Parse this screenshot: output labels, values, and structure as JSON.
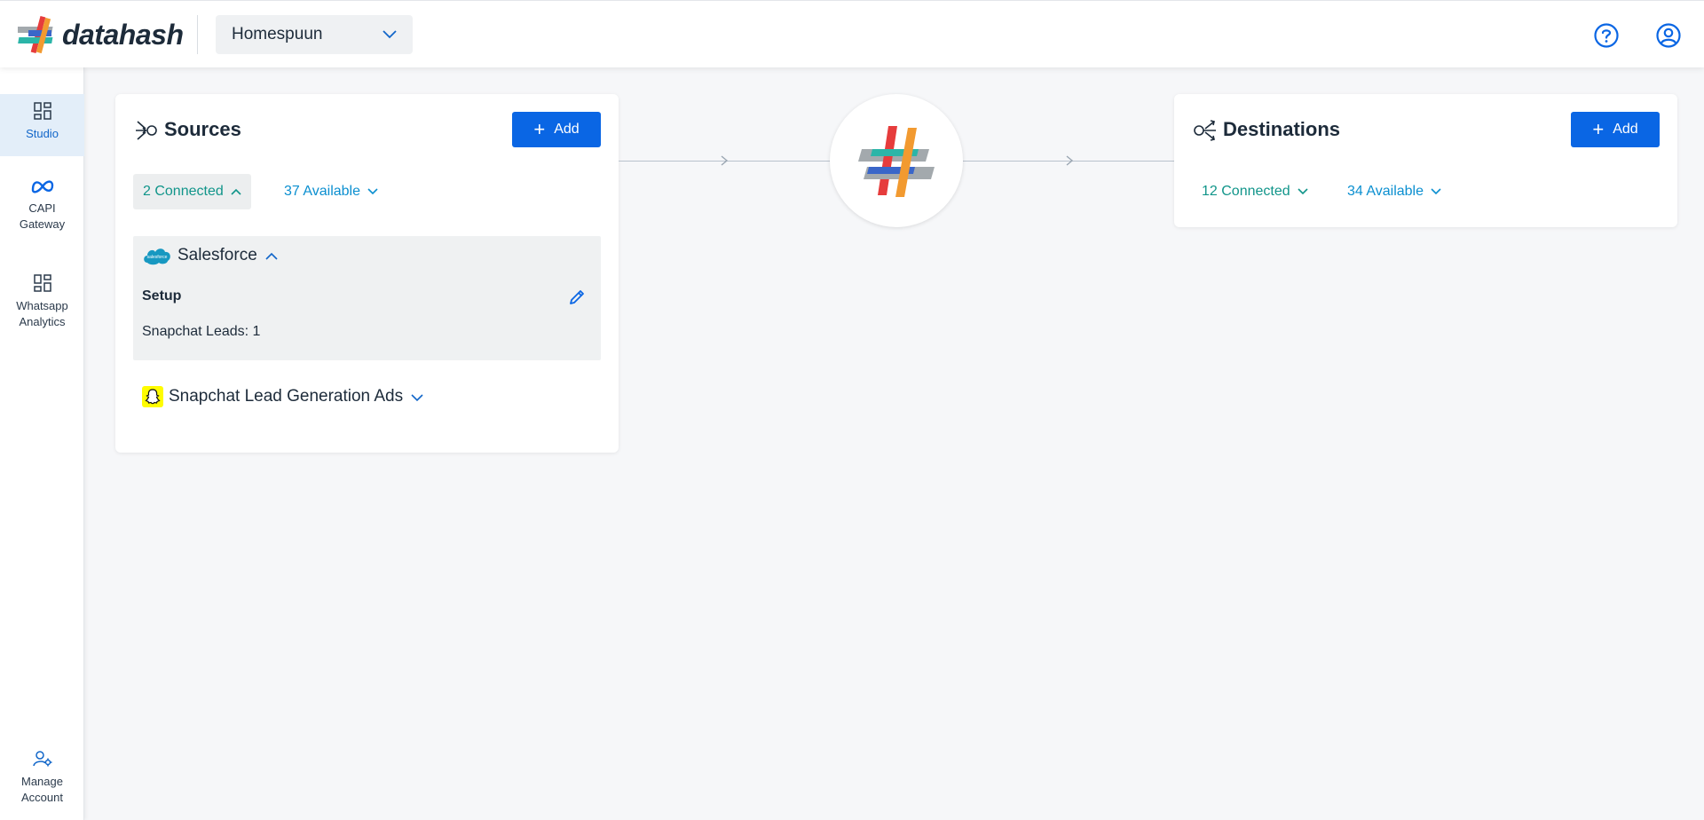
{
  "header": {
    "logo_text": "datahash",
    "workspace": "Homespuun",
    "help_icon": "help-circle-icon",
    "account_icon": "user-circle-icon"
  },
  "sidebar": {
    "items": [
      {
        "label_line1": "Studio",
        "label_line2": "",
        "icon": "dashboard-icon"
      },
      {
        "label_line1": "CAPI",
        "label_line2": "Gateway",
        "icon": "meta-icon"
      },
      {
        "label_line1": "Whatsapp",
        "label_line2": "Analytics",
        "icon": "dashboard-icon"
      },
      {
        "label_line1": "Manage",
        "label_line2": "Account",
        "icon": "user-settings-icon"
      }
    ]
  },
  "sources": {
    "title": "Sources",
    "add_label": "Add",
    "connected_label": "2 Connected",
    "available_label": "37 Available",
    "items": [
      {
        "name": "Salesforce",
        "logo_text": "salesforce",
        "setup_label": "Setup",
        "detail": "Snapchat Leads: 1"
      },
      {
        "name": "Snapchat Lead Generation Ads"
      }
    ]
  },
  "destinations": {
    "title": "Destinations",
    "add_label": "Add",
    "connected_label": "12 Connected",
    "available_label": "34 Available"
  },
  "colors": {
    "primary": "#0a66e4",
    "teal": "#11958a",
    "sky": "#0b8fd0",
    "hash_red": "#e63c3c",
    "hash_teal": "#2bb5a8",
    "hash_blue": "#3a66c9",
    "hash_orange": "#f29a30",
    "hash_gray": "#a3a9ad"
  }
}
